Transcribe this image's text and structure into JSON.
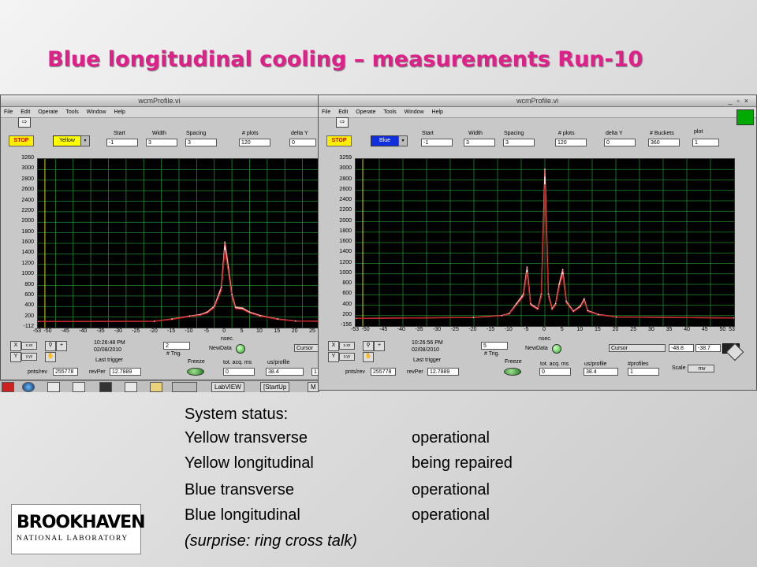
{
  "slide": {
    "title": "Blue longitudinal cooling – measurements Run-10"
  },
  "windows": {
    "left": {
      "title": "wcmProfile.vi",
      "menu": [
        "File",
        "Edit",
        "Operate",
        "Tools",
        "Window",
        "Help"
      ],
      "stop_label": "STOP",
      "ring_select": "Yellow",
      "ring_color": "#ffff00",
      "params": {
        "start_label": "Start",
        "start_value": "-1",
        "width_label": "Width",
        "width_value": "3",
        "spacing_label": "Spacing",
        "spacing_value": "3",
        "plots_label": "# plots",
        "plots_value": "120",
        "deltay_label": "delta Y",
        "deltay_value": "0"
      },
      "graph": {
        "y_ticks": [
          "3260",
          "3000",
          "2800",
          "2600",
          "2400",
          "2200",
          "2000",
          "1800",
          "1600",
          "1400",
          "1200",
          "1000",
          "800",
          "600",
          "400",
          "200",
          "-112"
        ],
        "x_ticks": [
          "-53",
          "-50",
          "-45",
          "-40",
          "-35",
          "-30",
          "-25",
          "-20",
          "-15",
          "-10",
          "-5",
          "0",
          "5",
          "10",
          "15",
          "20",
          "25"
        ],
        "x_min": -53,
        "x_max": 27,
        "y_min": -112,
        "y_max": 3260
      },
      "bottom": {
        "time": "10:26:48 PM",
        "date": "02/08/2010",
        "last_trigger_label": "Last trigger",
        "trig_value": "2",
        "trig_label": "# Trig.",
        "nsec_label": "nsec.",
        "newdata_label": "NewData",
        "cursor_label": "Cursor",
        "pnts_label": "pnts/rev",
        "pnts_value": "255778",
        "revper_label": "revPer",
        "revper_value": "12.7889",
        "freeze_label": "Freeze",
        "totacq_label": "tot. acq. ms",
        "totacq_value": "0",
        "usprofile_label": "us/profile",
        "usprofile_value": "38.4",
        "extra_value": "1"
      }
    },
    "right": {
      "title": "wcmProfile.vi",
      "menu": [
        "File",
        "Edit",
        "Operate",
        "Tools",
        "Window",
        "Help"
      ],
      "stop_label": "STOP",
      "ring_select": "Blue",
      "ring_color": "#1030e0",
      "params": {
        "start_label": "Start",
        "start_value": "-1",
        "width_label": "Width",
        "width_value": "3",
        "spacing_label": "Spacing",
        "spacing_value": "3",
        "plots_label": "# plots",
        "plots_value": "120",
        "deltay_label": "delta Y",
        "deltay_value": "0",
        "buckets_label": "# Buckets",
        "buckets_value": "360",
        "plot_label": "plot",
        "plot_value": "1"
      },
      "graph": {
        "y_ticks": [
          "3259",
          "3000",
          "2800",
          "2600",
          "2400",
          "2200",
          "2000",
          "1800",
          "1600",
          "1400",
          "1200",
          "1000",
          "800",
          "600",
          "400",
          "200",
          "-156"
        ],
        "x_ticks": [
          "-53",
          "-50",
          "-45",
          "-40",
          "-35",
          "-30",
          "-25",
          "-20",
          "-15",
          "-10",
          "-5",
          "0",
          "5",
          "10",
          "15",
          "20",
          "25",
          "30",
          "35",
          "40",
          "45",
          "50",
          "53"
        ],
        "x_min": -53,
        "x_max": 53,
        "y_min": -156,
        "y_max": 3259
      },
      "bottom": {
        "time": "10:26:56 PM",
        "date": "02/08/2010",
        "last_trigger_label": "Last trigger",
        "trig_value": "5",
        "trig_label": "# Trig.",
        "nsec_label": "nsec.",
        "newdata_label": "NewData",
        "cursor_label": "Cursor",
        "cursor_x": "-48.8",
        "cursor_y": "-38.7",
        "pnts_label": "pnts/rev",
        "pnts_value": "255778",
        "revper_label": "revPer",
        "revper_value": "12.7889",
        "freeze_label": "Freeze",
        "totacq_label": "tot. acq. ms",
        "totacq_value": "0",
        "usprofile_label": "us/profile",
        "usprofile_value": "38.4",
        "profiles_label": "#profiles",
        "profiles_value": "1",
        "scale_label": "Scale",
        "scale_value": "mv"
      }
    }
  },
  "taskbar": {
    "items": [
      "LabVIEW",
      "[StartUp",
      "M"
    ]
  },
  "status": {
    "header": "System status:",
    "rows": [
      {
        "system": "Yellow transverse",
        "state": "operational"
      },
      {
        "system": "Yellow longitudinal",
        "state": "being repaired"
      },
      {
        "system": "Blue transverse",
        "state": "operational"
      },
      {
        "system": "Blue longitudinal",
        "state": "operational"
      }
    ],
    "note": "(surprise: ring cross talk)"
  },
  "logo": {
    "top": "BROOKHAVEN",
    "bottom": "NATIONAL LABORATORY"
  },
  "chart_data": [
    {
      "type": "line",
      "xlabel": "nsec.",
      "xlim": [
        -53,
        27
      ],
      "ylim": [
        -112,
        3260
      ],
      "series": [
        {
          "x": [
            -53,
            -20,
            -15,
            -10,
            -7,
            -5,
            -3,
            -1,
            0,
            1,
            2,
            3,
            5,
            7,
            10,
            15,
            20,
            27
          ],
          "values": [
            10,
            15,
            60,
            120,
            150,
            200,
            320,
            700,
            1600,
            1100,
            550,
            300,
            280,
            200,
            130,
            60,
            20,
            15
          ]
        }
      ]
    },
    {
      "type": "line",
      "xlabel": "nsec.",
      "xlim": [
        -53,
        53
      ],
      "ylim": [
        -156,
        3259
      ],
      "series": [
        {
          "x": [
            -53,
            -20,
            -12,
            -10,
            -8,
            -6,
            -5,
            -4,
            -2,
            -1,
            0,
            1,
            2,
            3,
            4,
            5,
            6,
            8,
            10,
            11,
            12,
            15,
            20,
            53
          ],
          "values": [
            0,
            20,
            60,
            100,
            300,
            500,
            1050,
            300,
            200,
            500,
            3050,
            500,
            200,
            300,
            700,
            1000,
            350,
            150,
            260,
            400,
            160,
            80,
            30,
            10
          ]
        }
      ]
    }
  ]
}
